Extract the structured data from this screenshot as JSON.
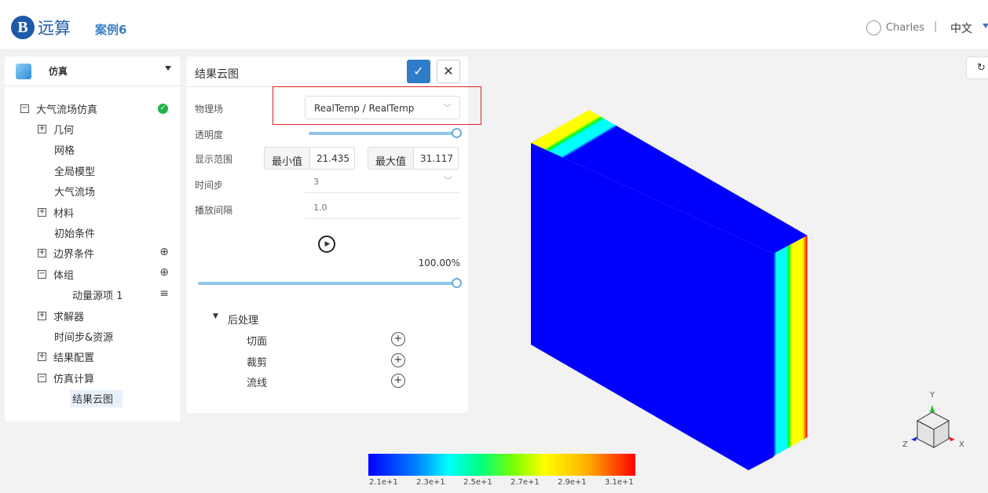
{
  "header": {
    "logo_text": "远算",
    "logo_letter": "B",
    "case": "案例6",
    "user": "Charles",
    "separator": "|",
    "lang": "中文",
    "refresh_icon": "↻"
  },
  "left": {
    "title": "仿真",
    "tree": [
      {
        "label": "大气流场仿真",
        "toggle": "−",
        "status": "✓"
      },
      {
        "label": "几何",
        "toggle": "+"
      },
      {
        "label": "网格"
      },
      {
        "label": "全局模型"
      },
      {
        "label": "大气流场"
      },
      {
        "label": "材料",
        "toggle": "+"
      },
      {
        "label": "初始条件"
      },
      {
        "label": "边界条件",
        "toggle": "+",
        "action": "⊕"
      },
      {
        "label": "体组",
        "toggle": "−",
        "action": "⊕"
      },
      {
        "label": "动量源项 1",
        "action": "≡"
      },
      {
        "label": "求解器",
        "toggle": "+"
      },
      {
        "label": "时间步&资源"
      },
      {
        "label": "结果配置",
        "toggle": "+"
      },
      {
        "label": "仿真计算",
        "toggle": "−"
      },
      {
        "label": "结果云图",
        "selected": true
      }
    ]
  },
  "panel": {
    "title": "结果云图",
    "confirm": "✓",
    "close": "✕",
    "field_label": "物理场",
    "field_value": "RealTemp / RealTemp",
    "opacity_label": "透明度",
    "opacity": 1.0,
    "range_label": "显示范围",
    "min_label": "最小值",
    "min_value": "21.435",
    "max_label": "最大值",
    "max_value": "31.117",
    "timestep_label": "时间步",
    "timestep_value": "3",
    "interval_label": "播放间隔",
    "interval_value": "1.0",
    "progress": "100.00%",
    "progress_value": 1.0,
    "post_label": "后处理",
    "post_items": [
      "切面",
      "裁剪",
      "流线"
    ]
  },
  "colorbar": {
    "labels": [
      "2.1e+1",
      "2.3e+1",
      "2.5e+1",
      "2.7e+1",
      "2.9e+1",
      "3.1e+1"
    ],
    "colors": [
      "#0000ff",
      "#00ffff",
      "#00ff00",
      "#ffff00",
      "#ff0000"
    ]
  },
  "axes": {
    "x": "X",
    "y": "Y",
    "z": "Z"
  },
  "accent": "#2f7cc9"
}
